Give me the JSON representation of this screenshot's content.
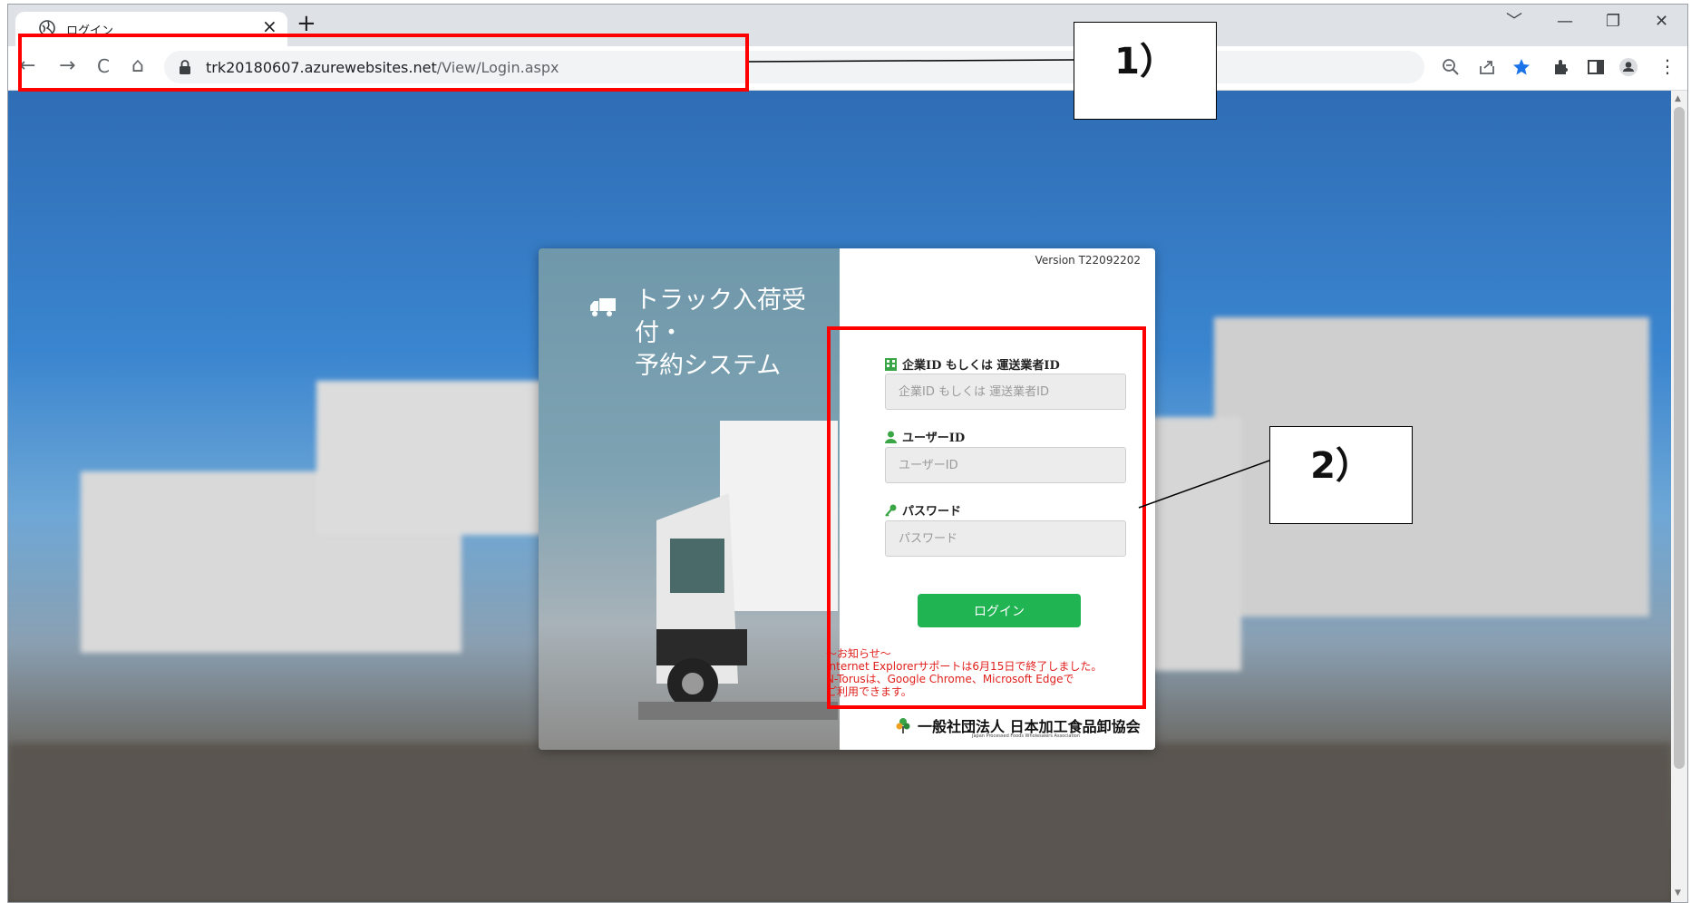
{
  "browser": {
    "tab_title": "ログイン",
    "tab_close": "×",
    "new_tab": "+",
    "window_controls": {
      "dropdown": "﹀",
      "minimize": "—",
      "restore": "❐",
      "close": "✕"
    },
    "nav": {
      "back": "←",
      "forward": "→",
      "reload": "C",
      "home": "⌂"
    },
    "url_host": "trk20180607.azurewebsites.net",
    "url_path": "/View/Login.aspx",
    "toolbar_icons": [
      "zoom-icon",
      "share-icon",
      "bookmark-star-icon",
      "extensions-icon",
      "side-panel-icon",
      "profile-icon",
      "menu-icon"
    ],
    "menu_glyph": "⋮"
  },
  "login": {
    "brand_line1": "トラック入荷受付・",
    "brand_line2": "予約システム",
    "version": "Version T22092202",
    "company_label": "企業ID もしくは 運送業者ID",
    "company_placeholder": "企業ID もしくは 運送業者ID",
    "user_label": "ユーザーID",
    "user_placeholder": "ユーザーID",
    "password_label": "パスワード",
    "password_placeholder": "パスワード",
    "login_button": "ログイン",
    "notice": [
      "～お知らせ～",
      "Internet Explorerサポートは6月15日で終了しました。",
      "N-Torusは、Google Chrome、Microsoft Edgeで",
      "ご利用できます。"
    ],
    "org_name": "一般社団法人 日本加工食品卸協会",
    "org_sub": "Japan Processed Foods Wholesalers Association"
  },
  "annotations": {
    "callout1": "1）",
    "callout2": "2）"
  },
  "colors": {
    "annotation_red": "#ff0000",
    "login_green": "#20b453",
    "notice_red": "#e0201c",
    "icon_green": "#3aa545"
  }
}
